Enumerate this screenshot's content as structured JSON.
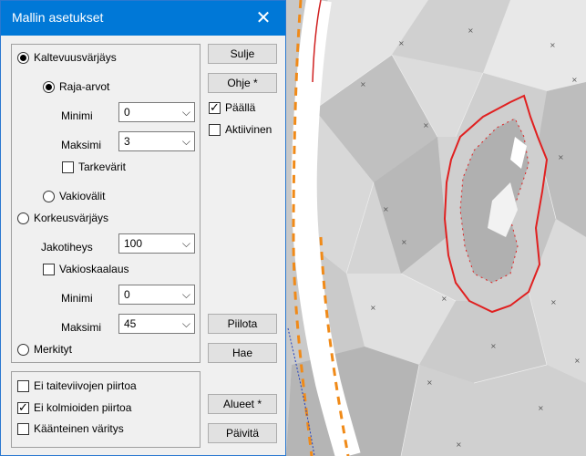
{
  "dialog": {
    "title": "Mallin asetukset",
    "close_icon": "close-icon"
  },
  "coloring": {
    "slope": {
      "label": "Kaltevuusvärjäys",
      "selected": true
    },
    "limits": {
      "label": "Raja-arvot",
      "selected": true
    },
    "slope_min": {
      "label": "Minimi",
      "value": "0"
    },
    "slope_max": {
      "label": "Maksimi",
      "value": "3"
    },
    "precise_colors": {
      "label": "Tarkevärit",
      "checked": false
    },
    "constant_intervals": {
      "label": "Vakiovälit",
      "selected": false
    },
    "elevation": {
      "label": "Korkeusvärjäys",
      "selected": false
    },
    "division": {
      "label": "Jakotiheys",
      "value": "100"
    },
    "constant_scaling": {
      "label": "Vakioskaalaus",
      "checked": false
    },
    "elev_min": {
      "label": "Minimi",
      "value": "0"
    },
    "elev_max": {
      "label": "Maksimi",
      "value": "45"
    },
    "marked": {
      "label": "Merkityt",
      "selected": false
    }
  },
  "options": {
    "no_breaklines": {
      "label": "Ei taiteviivojen piirtoa",
      "checked": false
    },
    "no_triangles": {
      "label": "Ei kolmioiden piirtoa",
      "checked": true
    },
    "inverse_coloring": {
      "label": "Käänteinen väritys",
      "checked": false
    }
  },
  "buttons": {
    "close": "Sulje",
    "help": "Ohje *",
    "hide": "Piilota",
    "fetch": "Hae",
    "areas": "Alueet *",
    "update": "Päivitä"
  },
  "toggles": {
    "on": {
      "label": "Päällä",
      "checked": true
    },
    "active": {
      "label": "Aktiivinen",
      "checked": false
    }
  },
  "check_glyph": "✓",
  "chevron_glyph": "⌵"
}
